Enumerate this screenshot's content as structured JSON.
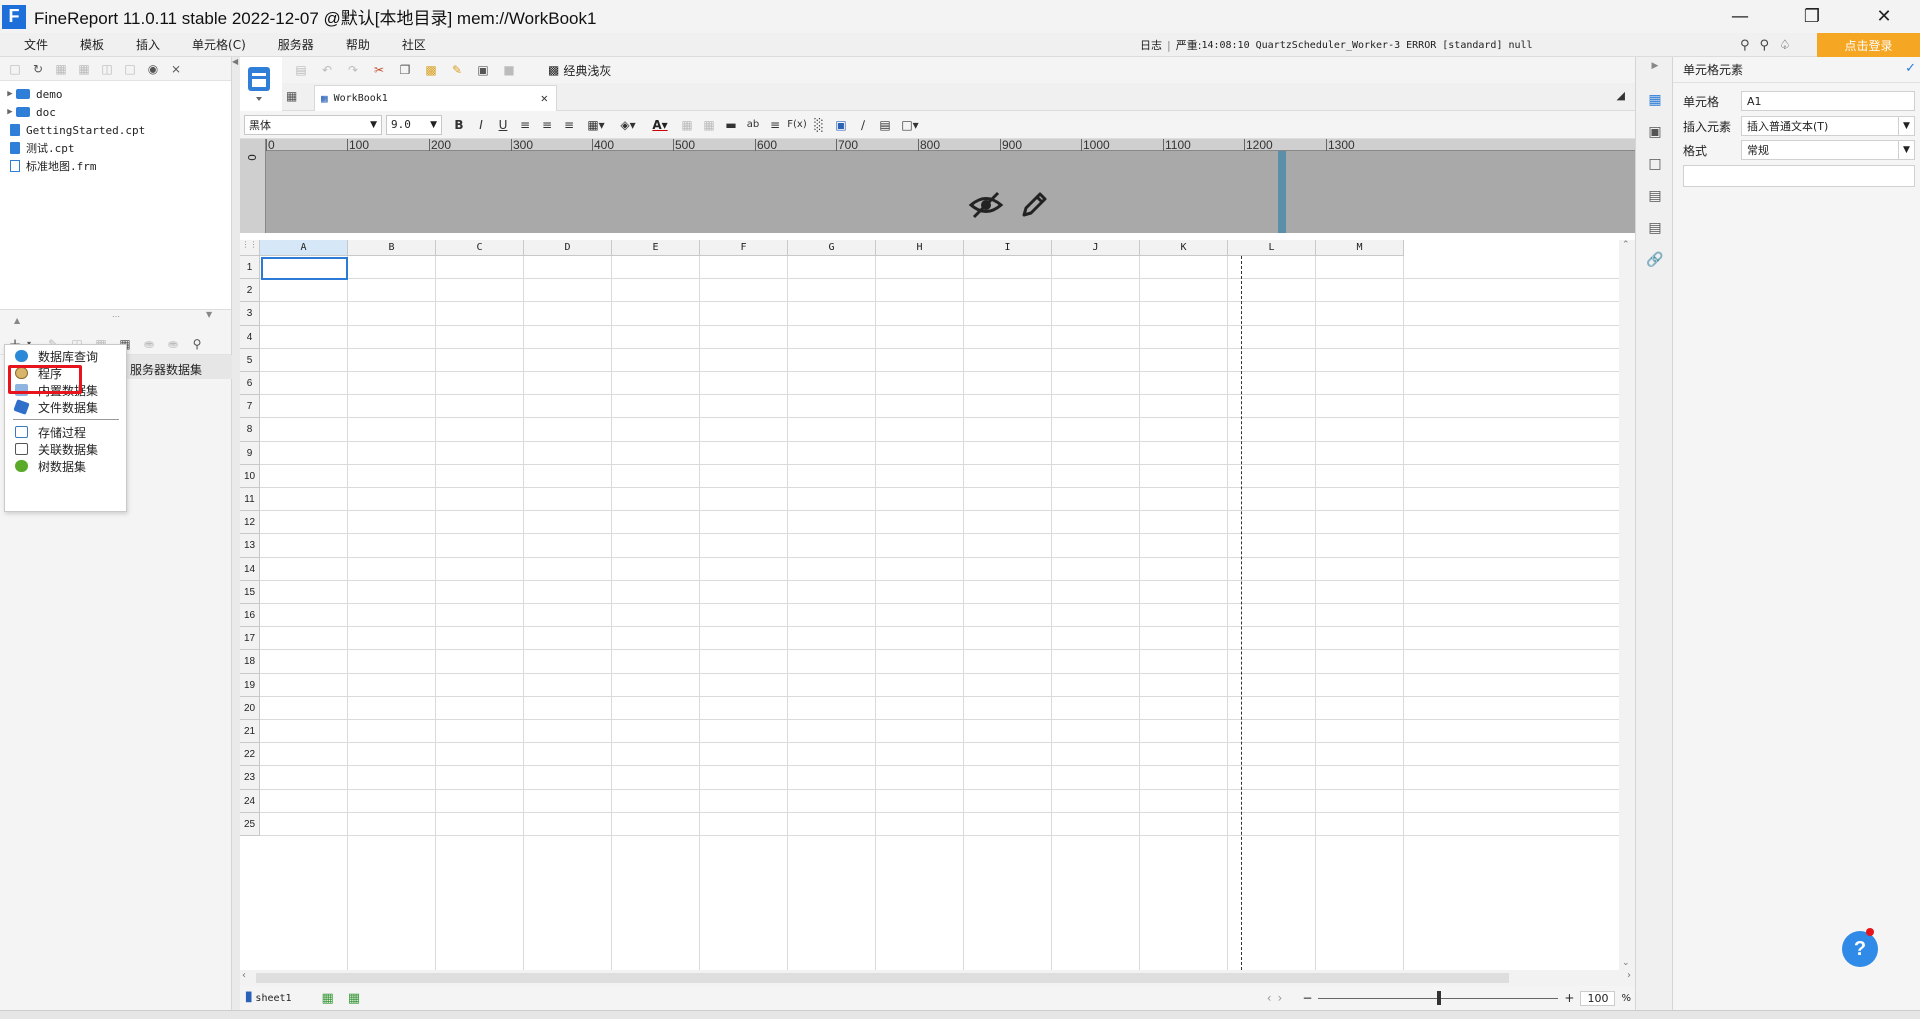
{
  "window": {
    "title": "FineReport 11.0.11 stable 2022-12-07 @默认[本地目录]    mem://WorkBook1",
    "minimize_icon": "minimize-icon",
    "maximize_icon": "restore-icon",
    "close_icon": "close-icon"
  },
  "menubar": {
    "items": [
      "文件",
      "模板",
      "插入",
      "单元格(C)",
      "服务器",
      "帮助",
      "社区"
    ],
    "log_label": "日志",
    "log_severity": "严重",
    "log_message": "14:08:10 QuartzScheduler_Worker-3 ERROR [standard] null",
    "login_button": "点击登录"
  },
  "file_tree": {
    "items": [
      {
        "name": "demo",
        "type": "folder"
      },
      {
        "name": "doc",
        "type": "folder"
      },
      {
        "name": "GettingStarted.cpt",
        "type": "cpt"
      },
      {
        "name": "测试.cpt",
        "type": "cpt"
      },
      {
        "name": "标准地图.frm",
        "type": "frm"
      }
    ]
  },
  "datasets": {
    "server_tab_label": "服务器数据集",
    "dropdown_items": [
      {
        "label": "数据库查询",
        "icon": "database-icon",
        "color": "#2b8ad8"
      },
      {
        "label": "程序",
        "icon": "program-icon",
        "color": "#b58a3c"
      },
      {
        "label": "内置数据集",
        "icon": "builtin-data-icon",
        "color": "#4b8ad0"
      },
      {
        "label": "文件数据集",
        "icon": "file-data-icon",
        "color": "#2f6fc9"
      },
      {
        "label": "存储过程",
        "icon": "stored-procedure-icon",
        "color": "#3c78c0"
      },
      {
        "label": "关联数据集",
        "icon": "relation-data-icon",
        "color": "#555555"
      },
      {
        "label": "树数据集",
        "icon": "tree-data-icon",
        "color": "#5aaa2a"
      }
    ],
    "highlight_color": "#e8141c"
  },
  "editor": {
    "classic_gray_label": "经典浅灰",
    "tab_title": "WorkBook1",
    "font_name": "黑体",
    "font_size": "9.0",
    "ruler_labels": [
      "0",
      "100",
      "200",
      "300",
      "400",
      "500",
      "600",
      "700",
      "800",
      "900",
      "1000",
      "1100",
      "1200",
      "1300"
    ],
    "columns": [
      "A",
      "B",
      "C",
      "D",
      "E",
      "F",
      "G",
      "H",
      "I",
      "J",
      "K",
      "L",
      "M"
    ],
    "rows": [
      "1",
      "2",
      "3",
      "4",
      "5",
      "6",
      "7",
      "8",
      "9",
      "10",
      "11",
      "12",
      "13",
      "14",
      "15",
      "16",
      "17",
      "18",
      "19",
      "20",
      "21",
      "22",
      "23",
      "24",
      "25"
    ],
    "sheet_name": "sheet1",
    "zoom_value": "100",
    "zoom_unit": "%",
    "zoom_minus": "−",
    "zoom_plus": "+"
  },
  "right_panel": {
    "title": "单元格元素",
    "cell_label": "单元格",
    "cell_value": "A1",
    "insert_label": "插入元素",
    "insert_value": "插入普通文本(T)",
    "format_label": "格式",
    "format_value": "常规"
  },
  "help": {
    "label": "?"
  },
  "colors": {
    "accent": "#2a7ad6",
    "login": "#f5a623",
    "highlight": "#e8141c"
  }
}
